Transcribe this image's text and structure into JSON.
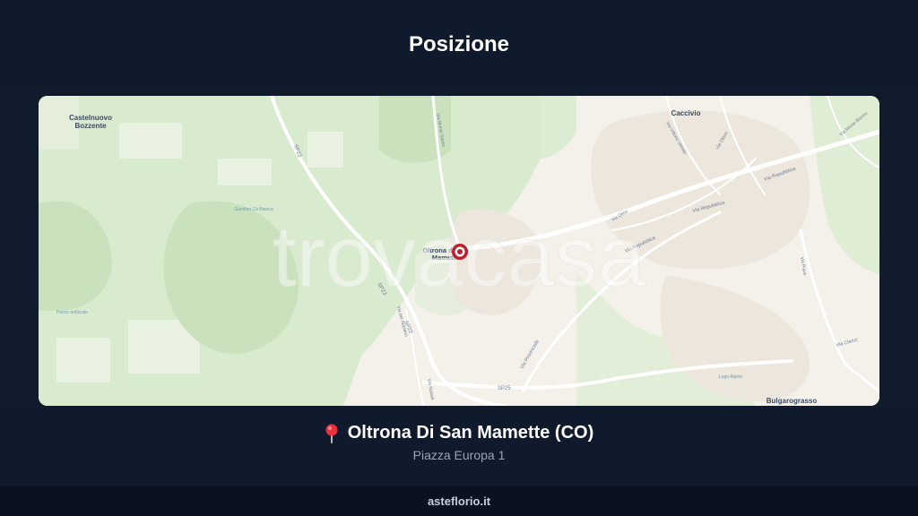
{
  "page": {
    "title": "Posizione"
  },
  "map": {
    "watermark": "trovacasa",
    "places": {
      "castelnuovo_line1": "Castelnuovo",
      "castelnuovo_line2": "Bozzente",
      "caccivio": "Caccivio",
      "bulgarograsso": "Bulgarograsso",
      "oltrona_line1": "Oltrona di San",
      "oltrona_line2": "Mamette"
    },
    "roads": {
      "sp23_north": "SP23",
      "sp23_south": "SP23",
      "sp23_mid": "SP23",
      "sp25": "SP25",
      "via_monte_sasso": "Via Monte Sasso",
      "via_repubblica_1": "Via Repubblica",
      "via_repubblica_2": "Via Repubblica",
      "via_repubblica_3": "Via Repubblica",
      "via_provinciale": "Via Provinciale",
      "via_per_appiano": "Via per Appiano",
      "via_olmo": "Via Olmo",
      "via_clerici": "Via Clerici",
      "via_monte_bianco": "Via Monte Bianco",
      "via_piave": "Via Piave",
      "via_ottoni": "Via Ottoni",
      "via_vittorio_veneto": "Via Vittorio Veneto",
      "via_statale": "Via Statale"
    },
    "features": {
      "green_area": "Giardino Cà Bianca",
      "pozzo": "Pozzo artificiale",
      "lago": "Lago Alpino"
    },
    "marker": "oltrona-location-marker"
  },
  "location": {
    "name": "Oltrona Di San Mamette (CO)",
    "address": "Piazza Europa 1"
  },
  "footer": {
    "brand": "asteflorio.it"
  },
  "colors": {
    "background": "#0f1a2c",
    "map_land": "#f4f1ea",
    "map_green": "#d9ebcf",
    "marker": "#c0202e"
  }
}
